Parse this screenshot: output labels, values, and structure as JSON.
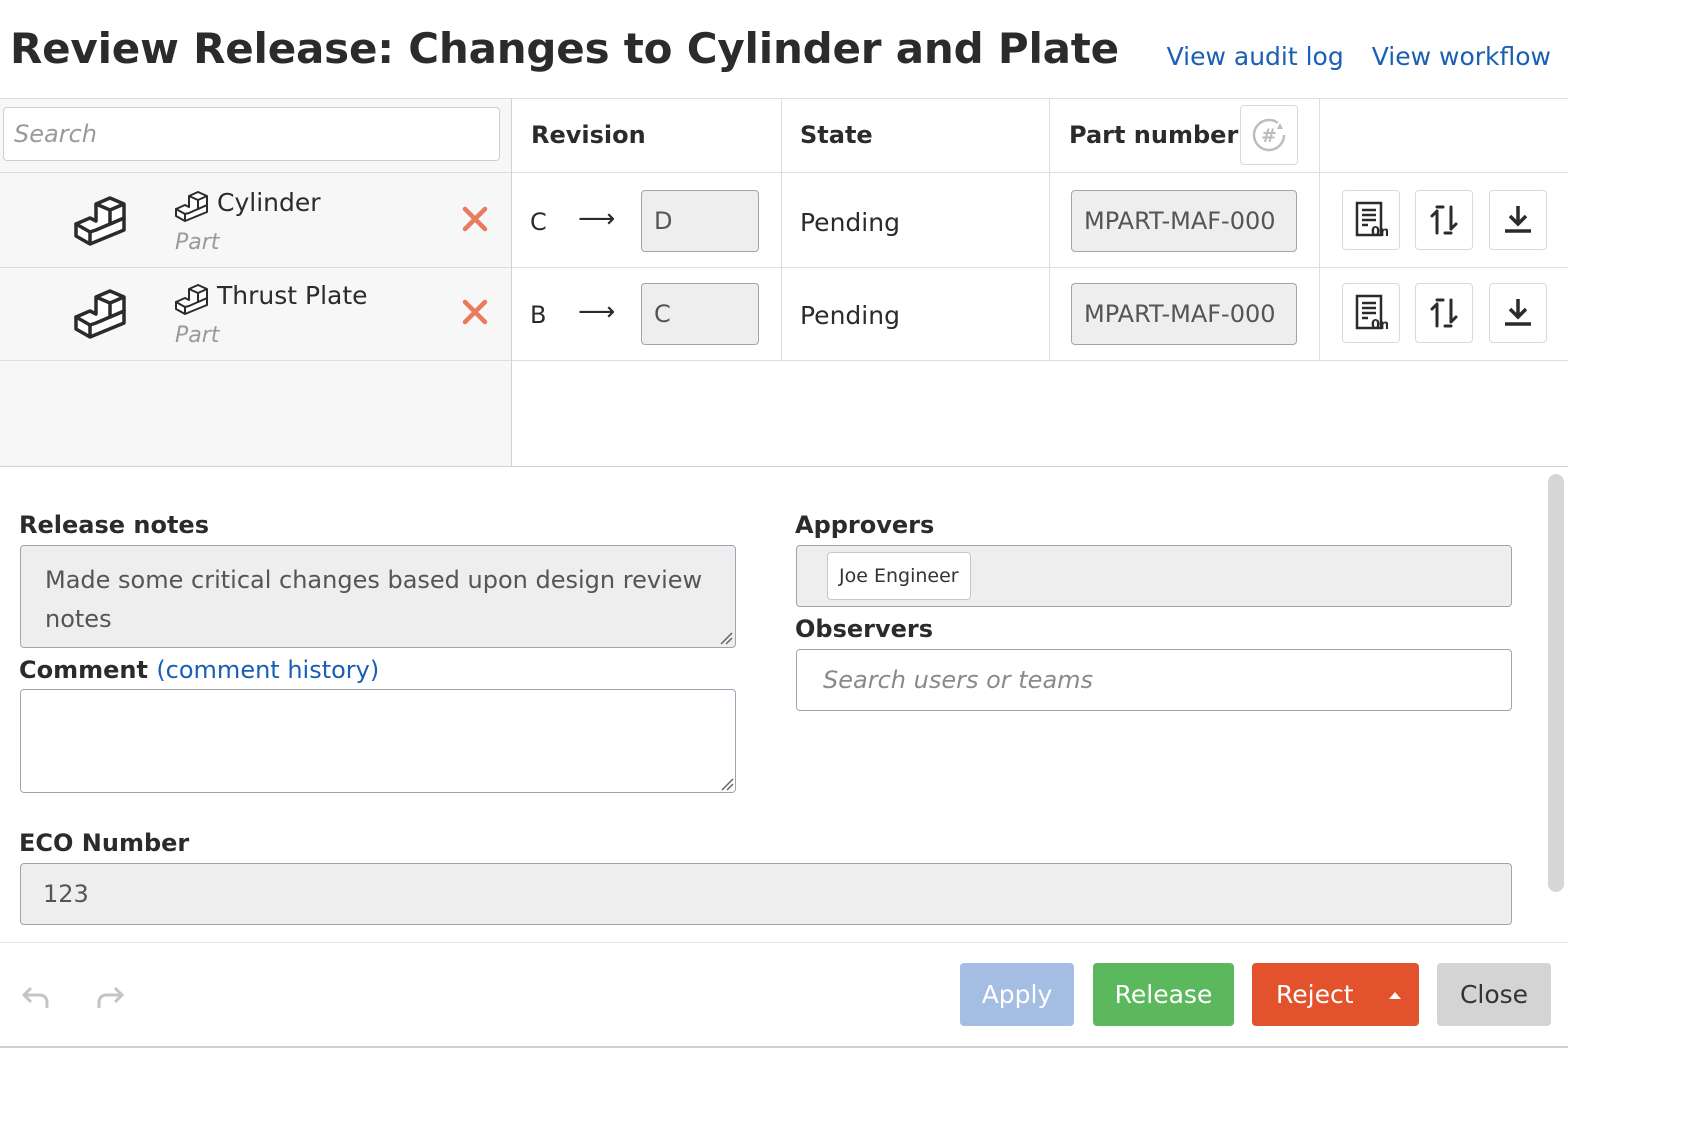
{
  "header": {
    "title": "Review Release: Changes to Cylinder and Plate",
    "audit_link": "View audit log",
    "workflow_link": "View workflow"
  },
  "table": {
    "search_placeholder": "Search",
    "columns": {
      "revision": "Revision",
      "state": "State",
      "part_number": "Part number"
    },
    "rows": [
      {
        "name": "Cylinder",
        "type": "Part",
        "rev_old": "C",
        "arrow": "⟶",
        "rev_new": "D",
        "state": "Pending",
        "part_number": "MPART-MAF-000"
      },
      {
        "name": "Thrust Plate",
        "type": "Part",
        "rev_old": "B",
        "arrow": "⟶",
        "rev_new": "C",
        "state": "Pending",
        "part_number": "MPART-MAF-000"
      }
    ]
  },
  "form": {
    "release_notes_label": "Release notes",
    "release_notes": "Made some critical changes based upon design review notes",
    "comment_label": "Comment",
    "comment_history_link": "(comment history)",
    "comment_value": "",
    "approvers_label": "Approvers",
    "approvers": [
      "Joe Engineer"
    ],
    "observers_label": "Observers",
    "observers_placeholder": "Search users or teams",
    "eco_label": "ECO Number",
    "eco_value": "123"
  },
  "footer": {
    "apply": "Apply",
    "release": "Release",
    "reject": "Reject",
    "close": "Close"
  },
  "colors": {
    "link": "#1a5fb4",
    "apply": "#a3bde3",
    "release": "#5cb85c",
    "reject": "#e2532d",
    "close": "#d4d4d4",
    "remove": "#e87a5d"
  }
}
